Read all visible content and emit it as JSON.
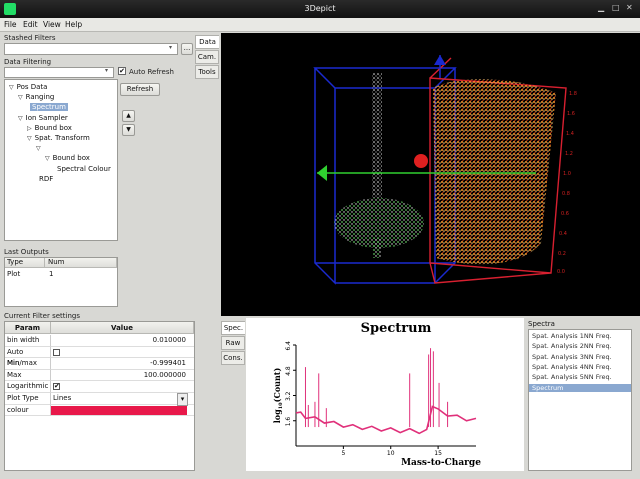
{
  "window": {
    "title": "3Depict"
  },
  "menu": [
    "File",
    "Edit",
    "View",
    "Help"
  ],
  "left": {
    "stashed_label": "Stashed Filters",
    "stash_button": "...",
    "data_filtering_label": "Data Filtering",
    "auto_refresh_label": "Auto Refresh",
    "refresh_button": "Refresh",
    "tree": [
      {
        "label": "Pos Data",
        "indent": 0,
        "tri": "▽"
      },
      {
        "label": "Ranging",
        "indent": 1,
        "tri": "▽"
      },
      {
        "label": "Spectrum",
        "indent": 2,
        "tri": "",
        "selected": true
      },
      {
        "label": "Ion Sampler",
        "indent": 1,
        "tri": "▽"
      },
      {
        "label": "Bound box",
        "indent": 2,
        "tri": "▷"
      },
      {
        "label": "Spat. Transform",
        "indent": 2,
        "tri": "▽"
      },
      {
        "label": "",
        "indent": 3,
        "tri": "▽"
      },
      {
        "label": "Bound box",
        "indent": 4,
        "tri": "▽"
      },
      {
        "label": "Spectral Colour",
        "indent": 5,
        "tri": ""
      },
      {
        "label": "RDF",
        "indent": 3,
        "tri": ""
      }
    ],
    "last_outputs_label": "Last Outputs",
    "outputs_headers": [
      "Type",
      "Num"
    ],
    "outputs_rows": [
      [
        "Plot",
        "1"
      ]
    ],
    "settings_label": "Current Filter settings",
    "settings_headers": [
      "Param",
      "Value"
    ],
    "settings_rows": [
      {
        "param": "bin width",
        "value": "0.010000"
      },
      {
        "param": "Auto Min/max",
        "value": "",
        "checkbox": false
      },
      {
        "param": "Min",
        "value": "-0.999401"
      },
      {
        "param": "Max",
        "value": "100.000000"
      },
      {
        "param": "Logarithmic",
        "value": "",
        "checkbox": true
      },
      {
        "param": "Plot Type",
        "value": "Lines",
        "dropdown": true
      },
      {
        "param": "colour",
        "value": "",
        "swatch": "#e8184a"
      }
    ]
  },
  "side_tabs": [
    "Data",
    "Cam.",
    "Tools"
  ],
  "bottom_tabs": [
    "Spec.",
    "Raw",
    "Cons."
  ],
  "spectra_panel": {
    "header": "Spectra",
    "items": [
      {
        "label": "Spat. Analysis 1NN Freq."
      },
      {
        "label": "Spat. Analysis 2NN Freq."
      },
      {
        "label": "Spat. Analysis 3NN Freq."
      },
      {
        "label": "Spat. Analysis 4NN Freq."
      },
      {
        "label": "Spat. Analysis 5NN Freq."
      },
      {
        "label": "Spectrum",
        "selected": true
      }
    ]
  },
  "view3d_axis_ticks": [
    "1.8",
    "1.6",
    "1.4",
    "1.2",
    "1.0",
    "0.8",
    "0.6",
    "0.4",
    "0.2",
    "0.0"
  ],
  "chart_data": {
    "type": "line",
    "title": "Spectrum",
    "xlabel": "Mass-to-Charge",
    "ylabel": "log10(Count)",
    "ylabel_prefix": "log",
    "ylabel_sub": "10",
    "ylabel_suffix": "(Count)",
    "xlim": [
      0,
      19
    ],
    "ylim": [
      0,
      6.4
    ],
    "xticks": [
      "5",
      "10",
      "15"
    ],
    "xtick_values": [
      5,
      10,
      15
    ],
    "yticks": [
      "1.6",
      "3.2",
      "4.8",
      "6.4"
    ],
    "ytick_values": [
      1.6,
      3.2,
      4.8,
      6.4
    ],
    "series_color": "#e0307a",
    "baseline": [
      [
        0,
        2.2
      ],
      [
        0.5,
        2.0
      ],
      [
        1,
        1.85
      ],
      [
        2,
        1.7
      ],
      [
        3,
        1.55
      ],
      [
        4,
        1.4
      ],
      [
        5,
        1.3
      ],
      [
        6,
        1.2
      ],
      [
        7,
        1.15
      ],
      [
        8,
        1.1
      ],
      [
        9,
        1.05
      ],
      [
        10,
        1.0
      ],
      [
        11,
        0.95
      ],
      [
        12,
        0.95
      ],
      [
        13,
        0.9
      ],
      [
        13.8,
        0.9
      ],
      [
        14.4,
        2.6
      ],
      [
        15,
        2.2
      ],
      [
        16,
        2.0
      ],
      [
        17,
        1.8
      ],
      [
        18,
        1.7
      ],
      [
        19,
        1.6
      ]
    ],
    "peaks": [
      [
        1,
        5.0
      ],
      [
        1.3,
        2.6
      ],
      [
        2,
        2.8
      ],
      [
        2.4,
        4.6
      ],
      [
        3.2,
        2.4
      ],
      [
        12,
        4.6
      ],
      [
        14.0,
        5.8
      ],
      [
        14.2,
        6.2
      ],
      [
        14.5,
        6.0
      ],
      [
        15.1,
        4.0
      ],
      [
        16,
        2.8
      ]
    ]
  }
}
